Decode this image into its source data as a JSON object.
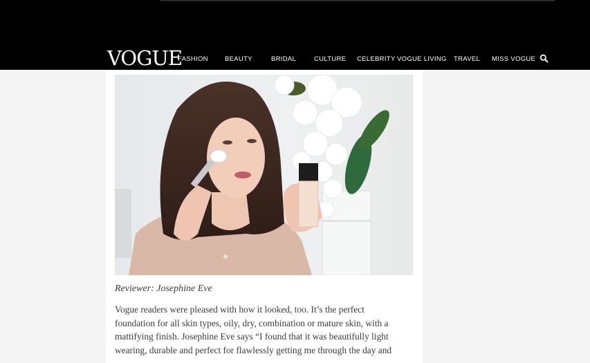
{
  "header": {
    "logo": "VOGUE",
    "nav": [
      "FASHION",
      "BEAUTY",
      "BRIDAL",
      "CULTURE",
      "CELEBRITY",
      "VOGUE LIVING",
      "TRAVEL",
      "MISS VOGUE"
    ],
    "search_icon": "search-icon"
  },
  "article": {
    "image_alt": "woman-applying-foundation-with-brush",
    "caption": "Reviewer: Josephine Eve",
    "lines": [
      "Vogue readers were pleased with how it looked, too. It’s the perfect",
      "foundation for all skin types, oily, dry, combination or mature skin, with a",
      "mattifying finish. Josephine Eve says “I found that it was beautifully light",
      "wearing, durable and perfect for flawlessly getting me through the day and"
    ]
  },
  "colors": {
    "header_bg": "#000000",
    "page_bg": "#f4f4f4",
    "text": "#3c3c3c"
  }
}
